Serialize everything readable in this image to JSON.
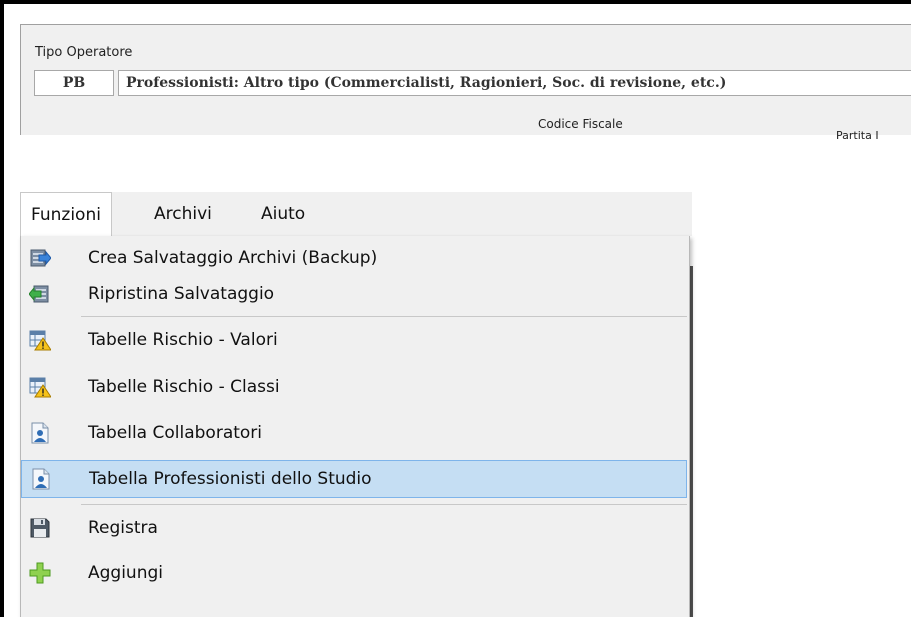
{
  "form": {
    "tipo_operatore_label": "Tipo Operatore",
    "code_value": "PB",
    "description_value": "Professionisti: Altro tipo (Commercialisti, Ragionieri, Soc. di revisione, etc.)",
    "codice_fiscale_label": "Codice Fiscale",
    "partita_iva_label": "Partita I"
  },
  "menubar": {
    "items": [
      {
        "label": "Funzioni",
        "active": true
      },
      {
        "label": "Archivi",
        "active": false
      },
      {
        "label": "Aiuto",
        "active": false
      }
    ]
  },
  "dropdown": {
    "items": [
      {
        "label": "Crea Salvataggio Archivi (Backup)",
        "icon": "backup-arrow-icon"
      },
      {
        "label": "Ripristina Salvataggio",
        "icon": "restore-icon"
      },
      {
        "label": "Tabelle Rischio - Valori",
        "icon": "table-warning-icon"
      },
      {
        "label": "Tabelle Rischio - Classi",
        "icon": "table-warning-icon"
      },
      {
        "label": "Tabella Collaboratori",
        "icon": "user-document-icon"
      },
      {
        "label": "Tabella Professionisti dello Studio",
        "icon": "user-document-icon",
        "highlighted": true
      },
      {
        "label": "Registra",
        "icon": "floppy-disk-icon"
      },
      {
        "label": "Aggiungi",
        "icon": "green-plus-icon"
      }
    ]
  },
  "colors": {
    "highlight_bg": "#c5def3",
    "highlight_border": "#7eb4ea",
    "menu_bg": "#f0f0f0"
  }
}
